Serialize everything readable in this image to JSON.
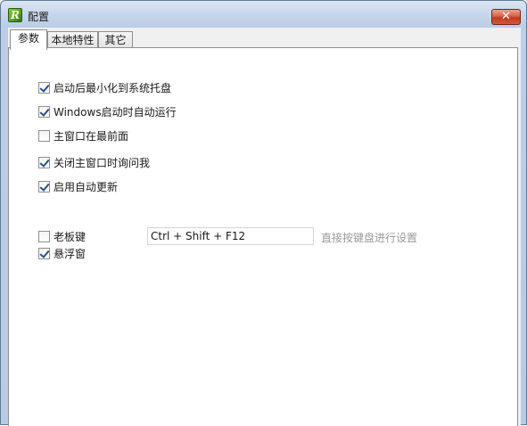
{
  "window": {
    "title": "配置",
    "app_icon_glyph": "R",
    "close_glyph": "✕"
  },
  "tabs": [
    {
      "label": "参数",
      "active": true
    },
    {
      "label": "本地特性",
      "active": false
    },
    {
      "label": "其它",
      "active": false
    }
  ],
  "options": {
    "minimize_to_tray": {
      "label": "启动后最小化到系统托盘",
      "checked": true
    },
    "autostart": {
      "label": "Windows启动时自动运行",
      "checked": true
    },
    "always_on_top": {
      "label": "主窗口在最前面",
      "checked": false
    },
    "ask_on_close": {
      "label": "关闭主窗口时询问我",
      "checked": true
    },
    "auto_update": {
      "label": "启用自动更新",
      "checked": true
    },
    "boss_key": {
      "label": "老板键",
      "checked": false
    },
    "float_window": {
      "label": "悬浮窗",
      "checked": true
    }
  },
  "hotkey": {
    "value": "Ctrl + Shift + F12",
    "hint": "直接按键盘进行设置"
  }
}
